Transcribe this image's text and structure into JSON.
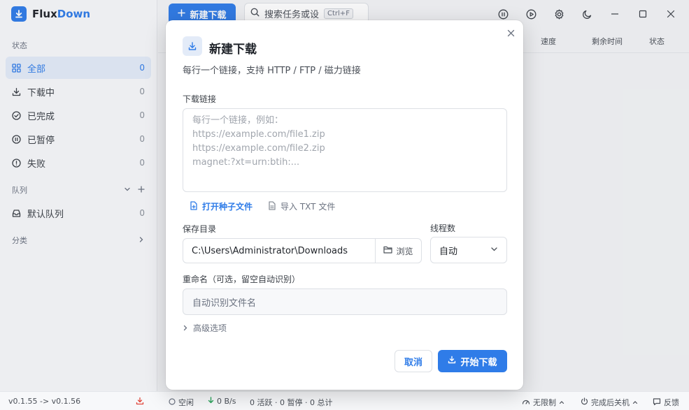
{
  "app": {
    "name_prefix": "Flux",
    "name_suffix": "Down",
    "accent": "#2f7ce8"
  },
  "sidebar": {
    "status_label": "状态",
    "items": [
      {
        "label": "全部",
        "count": "0",
        "icon": "grid-icon"
      },
      {
        "label": "下载中",
        "count": "0",
        "icon": "download-icon"
      },
      {
        "label": "已完成",
        "count": "0",
        "icon": "check-circle-icon"
      },
      {
        "label": "已暂停",
        "count": "0",
        "icon": "pause-circle-icon"
      },
      {
        "label": "失败",
        "count": "0",
        "icon": "alert-circle-icon"
      }
    ],
    "queue_label": "队列",
    "queues": [
      {
        "label": "默认队列",
        "count": "0",
        "icon": "inbox-icon"
      }
    ],
    "category_label": "分类"
  },
  "toolbar": {
    "new_label": "新建下载",
    "search_placeholder": "搜索任务或设",
    "search_shortcut": "Ctrl+F"
  },
  "table": {
    "columns": [
      "速度",
      "剩余时间",
      "状态"
    ]
  },
  "dialog": {
    "title": "新建下载",
    "subtitle": "每行一个链接，支持 HTTP / FTP / 磁力链接",
    "url_label": "下载链接",
    "url_placeholder": "每行一个链接，例如：\nhttps://example.com/file1.zip\nhttps://example.com/file2.zip\nmagnet:?xt=urn:btih:...",
    "open_torrent": "打开种子文件",
    "import_txt": "导入 TXT 文件",
    "dir_label": "保存目录",
    "dir_value": "C:\\Users\\Administrator\\Downloads",
    "browse": "浏览",
    "threads_label": "线程数",
    "threads_value": "自动",
    "rename_label": "重命名（可选，留空自动识别）",
    "rename_placeholder": "自动识别文件名",
    "advanced": "高级选项",
    "cancel": "取消",
    "start": "开始下载"
  },
  "statusbar": {
    "version": "v0.1.55 -> v0.1.56",
    "idle": "空闲",
    "speed": "0 B/s",
    "summary": "0 活跃 · 0 暂停 · 0 总计",
    "limit": "无限制",
    "shutdown": "完成后关机",
    "feedback": "反馈"
  }
}
